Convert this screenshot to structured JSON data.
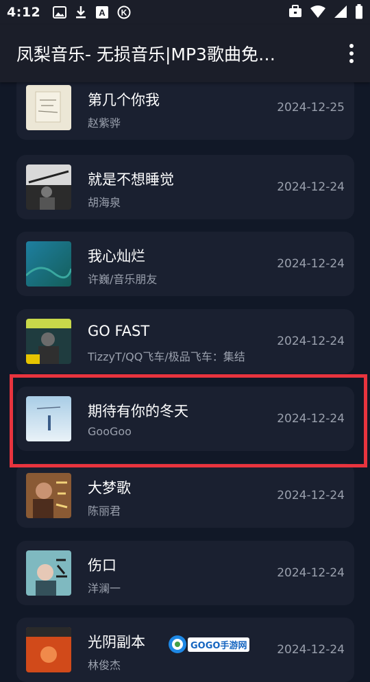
{
  "status_bar": {
    "time": "4:12",
    "icons_left": [
      "image-icon",
      "download-icon",
      "a-box-icon",
      "k-circle-icon"
    ],
    "icons_right": [
      "briefcase-icon",
      "wifi-icon",
      "signal-icon",
      "battery-icon"
    ]
  },
  "app_bar": {
    "title": "凤梨音乐- 无损音乐|MP3歌曲免…",
    "menu_icon": "more-vert-icon"
  },
  "songs": [
    {
      "title": "第几个你我",
      "artist": "赵紫骅",
      "date": "2024-12-25"
    },
    {
      "title": "就是不想睡觉",
      "artist": "胡海泉",
      "date": "2024-12-24"
    },
    {
      "title": "我心灿烂",
      "artist": "许巍/音乐朋友",
      "date": "2024-12-24"
    },
    {
      "title": "GO FAST",
      "artist": "TizzyT/QQ飞车/极品飞车：集结",
      "date": "2024-12-24"
    },
    {
      "title": "期待有你的冬天",
      "artist": "GooGoo",
      "date": "2024-12-24"
    },
    {
      "title": "大梦歌",
      "artist": "陈丽君",
      "date": "2024-12-24"
    },
    {
      "title": "伤口",
      "artist": "洋澜一",
      "date": "2024-12-24"
    },
    {
      "title": "光阴副本",
      "artist": "林俊杰",
      "date": "2024-12-24"
    }
  ],
  "highlight_color": "#e8343e",
  "watermark": {
    "logo_icon": "gogo-logo-icon",
    "text": "GOGO手游网"
  }
}
